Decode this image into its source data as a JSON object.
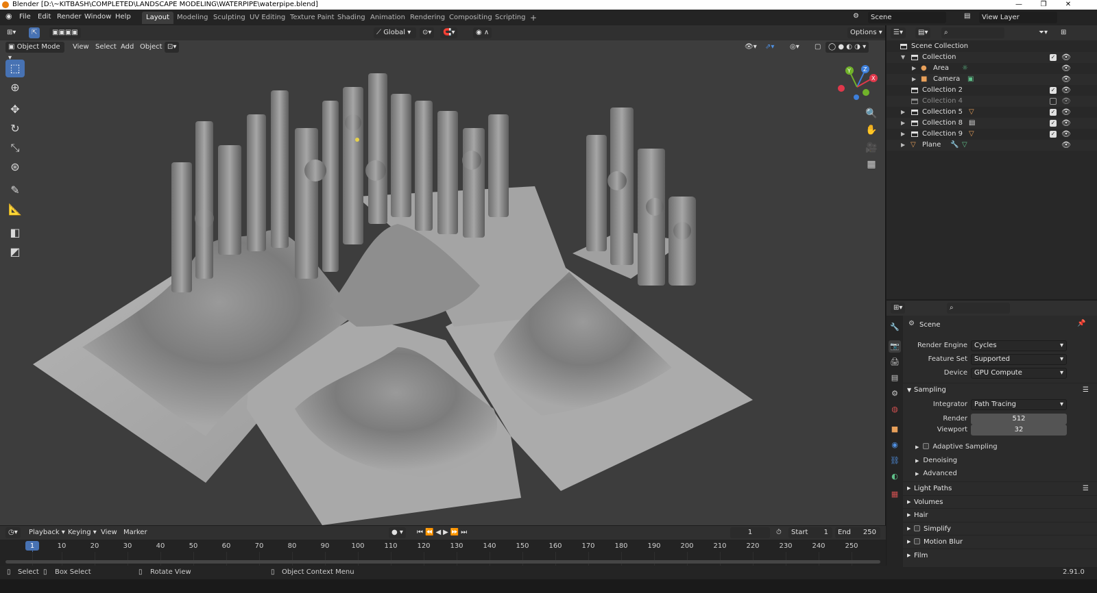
{
  "window": {
    "title": "Blender [D:\\~KITBASH\\COMPLETED\\LANDSCAPE MODELING\\WATERPIPE\\waterpipe.blend]",
    "minimize": "—",
    "maximize": "❐",
    "close": "✕"
  },
  "menu": {
    "items": [
      "File",
      "Edit",
      "Render",
      "Window",
      "Help"
    ]
  },
  "workspaces": [
    "Layout",
    "Modeling",
    "Sculpting",
    "UV Editing",
    "Texture Paint",
    "Shading",
    "Animation",
    "Rendering",
    "Compositing",
    "Scripting",
    "+"
  ],
  "active_workspace": "Layout",
  "scene_selector": {
    "value": "Scene"
  },
  "view_layer": {
    "value": "View Layer"
  },
  "viewport": {
    "transform_orientation": "Global",
    "options_label": "Options",
    "mode": "Object Mode",
    "header_menus": [
      "View",
      "Select",
      "Add",
      "Object"
    ],
    "gizmo_labels": {
      "x": "X",
      "y": "Y",
      "z": "Z"
    }
  },
  "timeline": {
    "menus": [
      "Playback",
      "Keying",
      "View",
      "Marker"
    ],
    "current_frame": "1",
    "start_label": "Start",
    "start_value": "1",
    "end_label": "End",
    "end_value": "250",
    "ticks": [
      "1",
      "10",
      "20",
      "30",
      "40",
      "50",
      "60",
      "70",
      "80",
      "90",
      "100",
      "110",
      "120",
      "130",
      "140",
      "150",
      "160",
      "170",
      "180",
      "190",
      "200",
      "210",
      "220",
      "230",
      "240",
      "250"
    ]
  },
  "statusbar": {
    "select": "Select",
    "box_select": "Box Select",
    "rotate_view": "Rotate View",
    "context_menu": "Object Context Menu",
    "version": "2.91.0"
  },
  "outliner": {
    "root": "Scene Collection",
    "rows": [
      {
        "label": "Collection",
        "checked": true
      },
      {
        "label": "Area",
        "checked": null
      },
      {
        "label": "Camera",
        "checked": null
      },
      {
        "label": "Collection 2",
        "checked": true
      },
      {
        "label": "Collection 4",
        "checked": false
      },
      {
        "label": "Collection 5",
        "checked": true
      },
      {
        "label": "Collection 8",
        "checked": true
      },
      {
        "label": "Collection 9",
        "checked": true
      },
      {
        "label": "Plane",
        "checked": null
      }
    ]
  },
  "properties": {
    "context": "Scene",
    "render_engine_label": "Render Engine",
    "render_engine": "Cycles",
    "feature_set_label": "Feature Set",
    "feature_set": "Supported",
    "device_label": "Device",
    "device": "GPU Compute",
    "sampling_label": "Sampling",
    "integrator_label": "Integrator",
    "integrator": "Path Tracing",
    "render_label": "Render",
    "render_samples": "512",
    "viewport_label": "Viewport",
    "viewport_samples": "32",
    "adaptive_sampling": "Adaptive Sampling",
    "denoising": "Denoising",
    "advanced": "Advanced",
    "panels": [
      "Light Paths",
      "Volumes",
      "Hair",
      "Simplify",
      "Motion Blur",
      "Film"
    ]
  },
  "colors": {
    "accent": "#4772b3",
    "viewport_bg": "#3d3d3d",
    "gizmo_x": "#e0384b",
    "gizmo_y": "#71b32a",
    "gizmo_z": "#3d7fdb"
  }
}
